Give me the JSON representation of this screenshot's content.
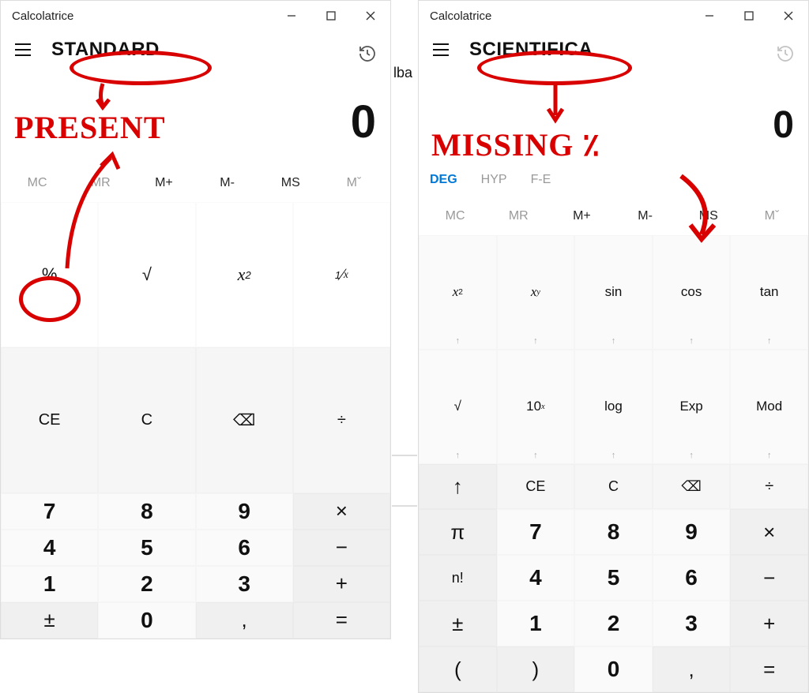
{
  "left": {
    "title": "Calcolatrice",
    "mode": "STANDARD",
    "display": "0",
    "memory": [
      "MC",
      "MR",
      "M+",
      "M-",
      "MS",
      "Mˇ"
    ],
    "funcRow": [
      "%",
      "√",
      "x²",
      "¹⁄ₓ"
    ],
    "row_ce": [
      "CE",
      "C",
      "⌫",
      "÷"
    ],
    "row7": [
      "7",
      "8",
      "9",
      "×"
    ],
    "row4": [
      "4",
      "5",
      "6",
      "−"
    ],
    "row1": [
      "1",
      "2",
      "3",
      "+"
    ],
    "row0": [
      "±",
      "0",
      ",",
      "="
    ]
  },
  "right": {
    "title": "Calcolatrice",
    "mode": "SCIENTIFICA",
    "display": "0",
    "modes": [
      "DEG",
      "HYP",
      "F-E"
    ],
    "memory": [
      "MC",
      "MR",
      "M+",
      "M-",
      "MS",
      "Mˇ"
    ],
    "func1": [
      "x²",
      "xʸ",
      "sin",
      "cos",
      "tan"
    ],
    "func2": [
      "√",
      "10ˣ",
      "log",
      "Exp",
      "Mod"
    ],
    "row_ce": [
      "↑",
      "CE",
      "C",
      "⌫",
      "÷"
    ],
    "row7": [
      "π",
      "7",
      "8",
      "9",
      "×"
    ],
    "row4": [
      "n!",
      "4",
      "5",
      "6",
      "−"
    ],
    "row1": [
      "±",
      "1",
      "2",
      "3",
      "+"
    ],
    "row0": [
      "(",
      ")",
      "0",
      ",",
      "="
    ]
  },
  "annotations": {
    "left_label": "PRESENT",
    "right_label": "MISSING ٪"
  },
  "between_label": "lba"
}
